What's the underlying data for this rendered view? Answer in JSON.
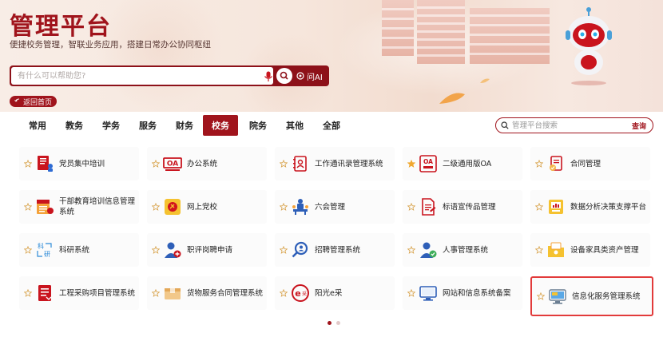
{
  "header": {
    "title": "管理平台",
    "subtitle": "便捷校务管理，智联业务应用，搭建日常办公协同枢纽"
  },
  "search": {
    "placeholder": "有什么可以帮助您?",
    "ai_label": "问AI"
  },
  "back": {
    "label": "返回首页"
  },
  "tabs": [
    {
      "label": "常用",
      "active": false
    },
    {
      "label": "教务",
      "active": false
    },
    {
      "label": "学务",
      "active": false
    },
    {
      "label": "服务",
      "active": false
    },
    {
      "label": "财务",
      "active": false
    },
    {
      "label": "校务",
      "active": true
    },
    {
      "label": "院务",
      "active": false
    },
    {
      "label": "其他",
      "active": false
    },
    {
      "label": "全部",
      "active": false
    }
  ],
  "tab_search": {
    "placeholder": "管理平台搜索",
    "button": "查询"
  },
  "apps": [
    {
      "label": "党员集中培训",
      "icon": "training-board-icon",
      "starred": false
    },
    {
      "label": "办公系统",
      "icon": "oa-icon",
      "starred": false
    },
    {
      "label": "工作通讯录管理系统",
      "icon": "contacts-icon",
      "starred": false
    },
    {
      "label": "二级通用版OA",
      "icon": "oa-secondary-icon",
      "starred": true
    },
    {
      "label": "合同管理",
      "icon": "contract-icon",
      "starred": false
    },
    {
      "label": "干部教育培训信息管理系统",
      "icon": "cadre-training-icon",
      "starred": false
    },
    {
      "label": "网上党校",
      "icon": "party-school-icon",
      "starred": false
    },
    {
      "label": "六会管理",
      "icon": "meeting-icon",
      "starred": false
    },
    {
      "label": "标语宣传品管理",
      "icon": "slogan-doc-icon",
      "starred": false
    },
    {
      "label": "数据分析决策支撑平台",
      "icon": "data-analysis-icon",
      "starred": false
    },
    {
      "label": "科研系统",
      "icon": "research-icon",
      "starred": false
    },
    {
      "label": "职评岗聘申请",
      "icon": "job-apply-icon",
      "starred": false
    },
    {
      "label": "招聘管理系统",
      "icon": "recruit-search-icon",
      "starred": false
    },
    {
      "label": "人事管理系统",
      "icon": "personnel-icon",
      "starred": false
    },
    {
      "label": "设备家具类资产管理",
      "icon": "asset-folder-icon",
      "starred": false
    },
    {
      "label": "工程采购项目管理系统",
      "icon": "procurement-icon",
      "starred": false
    },
    {
      "label": "货物服务合同管理系统",
      "icon": "goods-box-icon",
      "starred": false
    },
    {
      "label": "阳光e采",
      "icon": "e-purchase-icon",
      "starred": false
    },
    {
      "label": "网站和信息系统备案",
      "icon": "website-monitor-icon",
      "starred": false
    },
    {
      "label": "信息化服务管理系统",
      "icon": "it-service-monitor-icon",
      "starred": false
    }
  ],
  "pagination": {
    "pages": 2,
    "current": 1
  },
  "colors": {
    "brand": "#a0141c",
    "highlight_border": "#e23b3b",
    "star_filled": "#f0a830"
  }
}
